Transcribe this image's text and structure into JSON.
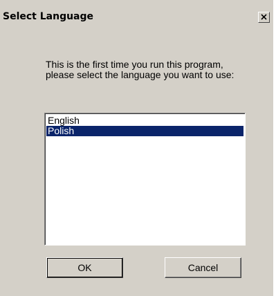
{
  "dialog": {
    "title": "Select Language",
    "close_symbol": "×",
    "message": "This is the first time you run this program, please select the language you want to use:",
    "languages": [
      "English",
      "Polish"
    ],
    "selected_language": "Polish",
    "ok_label": "OK",
    "cancel_label": "Cancel"
  },
  "icons": {
    "close": "close-icon"
  },
  "colors": {
    "dialog_face": "#d4d0c8",
    "selection_background": "#0a246a",
    "selection_text": "#ffffff"
  }
}
